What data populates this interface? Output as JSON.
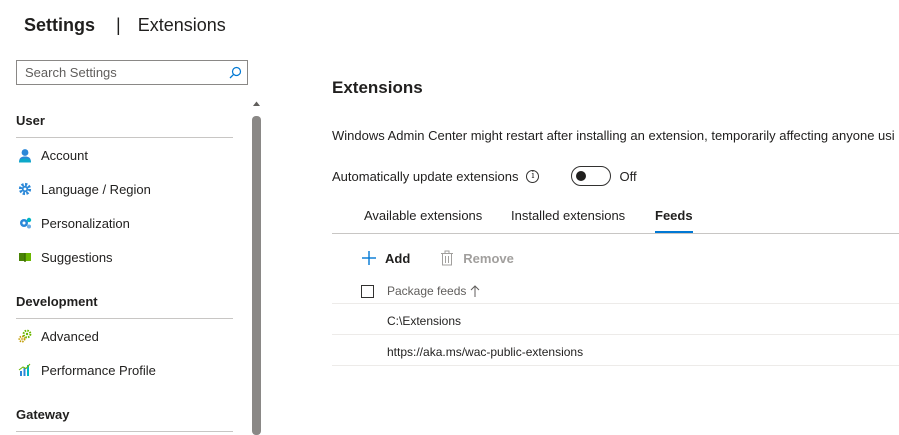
{
  "header": {
    "title": "Settings",
    "separator": "|",
    "subtitle": "Extensions"
  },
  "search": {
    "placeholder": "Search Settings",
    "value": "",
    "icon": "search-icon"
  },
  "sidebar": {
    "groups": [
      {
        "title": "User",
        "items": [
          {
            "label": "Account",
            "icon": "account-icon"
          },
          {
            "label": "Language / Region",
            "icon": "gear-icon"
          },
          {
            "label": "Personalization",
            "icon": "personalization-icon"
          },
          {
            "label": "Suggestions",
            "icon": "suggestions-book-icon"
          }
        ]
      },
      {
        "title": "Development",
        "items": [
          {
            "label": "Advanced",
            "icon": "advanced-gears-icon"
          },
          {
            "label": "Performance Profile",
            "icon": "performance-chart-icon"
          }
        ]
      },
      {
        "title": "Gateway",
        "items": []
      }
    ]
  },
  "main": {
    "title": "Extensions",
    "description": "Windows Admin Center might restart after installing an extension, temporarily affecting anyone usi",
    "auto_update": {
      "label": "Automatically update extensions",
      "info_glyph": "i",
      "toggle_state": "Off",
      "enabled": false
    },
    "tabs": [
      {
        "label": "Available extensions",
        "active": false
      },
      {
        "label": "Installed extensions",
        "active": false
      },
      {
        "label": "Feeds",
        "active": true
      }
    ],
    "commands": {
      "add_label": "Add",
      "remove_label": "Remove"
    },
    "grid": {
      "column_header": "Package feeds",
      "sort": "ascending",
      "rows": [
        {
          "feed": "C:\\Extensions"
        },
        {
          "feed": "https://aka.ms/wac-public-extensions"
        }
      ]
    }
  },
  "colors": {
    "accent": "#0078d4",
    "text": "#201f1e",
    "disabled": "#a19f9d",
    "divider": "#c8c6c4"
  }
}
